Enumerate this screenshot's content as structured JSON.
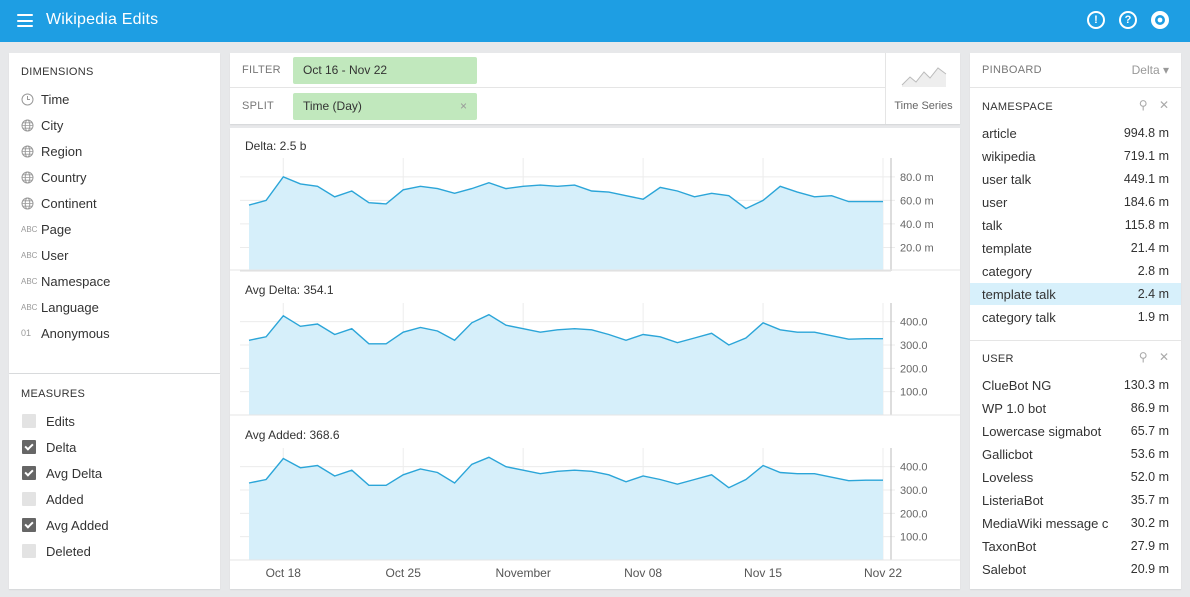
{
  "app": {
    "title": "Wikipedia Edits"
  },
  "topbar": {
    "icons": [
      "info-icon",
      "help-icon",
      "github-icon"
    ],
    "info_glyph": "!",
    "help_glyph": "?"
  },
  "dimensions": {
    "title": "DIMENSIONS",
    "items": [
      {
        "label": "Time",
        "icon": "clock-icon"
      },
      {
        "label": "City",
        "icon": "globe-icon"
      },
      {
        "label": "Region",
        "icon": "globe-icon"
      },
      {
        "label": "Country",
        "icon": "globe-icon"
      },
      {
        "label": "Continent",
        "icon": "globe-icon"
      },
      {
        "label": "Page",
        "icon": "abc-icon"
      },
      {
        "label": "User",
        "icon": "abc-icon"
      },
      {
        "label": "Namespace",
        "icon": "abc-icon"
      },
      {
        "label": "Language",
        "icon": "abc-icon"
      },
      {
        "label": "Anonymous",
        "icon": "boolean-icon"
      }
    ],
    "abc_glyph": "ABC",
    "bool_glyph": "01"
  },
  "measures": {
    "title": "MEASURES",
    "items": [
      {
        "label": "Edits",
        "checked": false
      },
      {
        "label": "Delta",
        "checked": true
      },
      {
        "label": "Avg Delta",
        "checked": true
      },
      {
        "label": "Added",
        "checked": false
      },
      {
        "label": "Avg Added",
        "checked": true
      },
      {
        "label": "Deleted",
        "checked": false
      }
    ]
  },
  "filter": {
    "label": "FILTER",
    "value": "Oct 16 - Nov 22"
  },
  "split": {
    "label": "SPLIT",
    "value": "Time (Day)",
    "remove_glyph": "×"
  },
  "visualization": {
    "label": "Time Series"
  },
  "chart_data": [
    {
      "type": "area",
      "title": "Delta: 2.5 b",
      "y_ticks": [
        "80.0 m",
        "60.0 m",
        "40.0 m",
        "20.0 m"
      ],
      "y_tick_values": [
        80,
        60,
        40,
        20
      ],
      "ylim": [
        0,
        96
      ],
      "unit": "m",
      "x_ticks": [
        "Oct 18",
        "Oct 25",
        "November",
        "Nov 08",
        "Nov 15",
        "Nov 22"
      ],
      "x_start": "Oct 16",
      "values": [
        56,
        60,
        80,
        74,
        72,
        63,
        68,
        58,
        57,
        69,
        72,
        70,
        66,
        70,
        75,
        70,
        72,
        73,
        72,
        73,
        68,
        67,
        64,
        61,
        71,
        68,
        63,
        66,
        64,
        53,
        60,
        72,
        67,
        63,
        64,
        59,
        59,
        59
      ]
    },
    {
      "type": "area",
      "title": "Avg Delta: 354.1",
      "y_ticks": [
        "400.0",
        "300.0",
        "200.0",
        "100.0"
      ],
      "y_tick_values": [
        400,
        300,
        200,
        100
      ],
      "ylim": [
        0,
        480
      ],
      "x_start": "Oct 16",
      "values": [
        320,
        335,
        425,
        380,
        390,
        345,
        370,
        305,
        305,
        355,
        375,
        360,
        320,
        395,
        430,
        385,
        370,
        355,
        365,
        370,
        365,
        345,
        320,
        345,
        335,
        310,
        330,
        350,
        300,
        330,
        395,
        365,
        355,
        355,
        340,
        325,
        327,
        327
      ]
    },
    {
      "type": "area",
      "title": "Avg Added: 368.6",
      "y_ticks": [
        "400.0",
        "300.0",
        "200.0",
        "100.0"
      ],
      "y_tick_values": [
        400,
        300,
        200,
        100
      ],
      "ylim": [
        0,
        480
      ],
      "x_start": "Oct 16",
      "values": [
        330,
        345,
        435,
        395,
        405,
        360,
        385,
        320,
        320,
        365,
        390,
        375,
        330,
        410,
        440,
        400,
        385,
        370,
        380,
        385,
        380,
        365,
        335,
        360,
        345,
        325,
        345,
        365,
        310,
        345,
        405,
        375,
        370,
        370,
        355,
        340,
        342,
        342
      ]
    }
  ],
  "pinboard": {
    "title": "PINBOARD",
    "sort": "Delta",
    "sort_glyph": "▾",
    "search_glyph": "⚲",
    "close_glyph": "✕",
    "namespace": {
      "title": "NAMESPACE",
      "rows": [
        {
          "label": "article",
          "value": "994.8 m"
        },
        {
          "label": "wikipedia",
          "value": "719.1 m"
        },
        {
          "label": "user talk",
          "value": "449.1 m"
        },
        {
          "label": "user",
          "value": "184.6 m"
        },
        {
          "label": "talk",
          "value": "115.8 m"
        },
        {
          "label": "template",
          "value": "21.4 m"
        },
        {
          "label": "category",
          "value": "2.8 m"
        },
        {
          "label": "template talk",
          "value": "2.4 m",
          "highlighted": true
        },
        {
          "label": "category talk",
          "value": "1.9 m"
        }
      ]
    },
    "user": {
      "title": "USER",
      "rows": [
        {
          "label": "ClueBot NG",
          "value": "130.3 m"
        },
        {
          "label": "WP 1.0 bot",
          "value": "86.9 m"
        },
        {
          "label": "Lowercase sigmabot",
          "value": "65.7 m"
        },
        {
          "label": "Gallicbot",
          "value": "53.6 m"
        },
        {
          "label": "Loveless",
          "value": "52.0 m"
        },
        {
          "label": "ListeriaBot",
          "value": "35.7 m"
        },
        {
          "label": "MediaWiki message c",
          "value": "30.2 m"
        },
        {
          "label": "TaxonBot",
          "value": "27.9 m"
        },
        {
          "label": "Salebot",
          "value": "20.9 m"
        }
      ]
    }
  },
  "colors": {
    "accent": "#1e9ee3",
    "series_line": "#2ba5d8",
    "series_fill": "#d6effa",
    "filter_pill": "#c1e8bd",
    "row_highlight": "#d7f0fb"
  }
}
